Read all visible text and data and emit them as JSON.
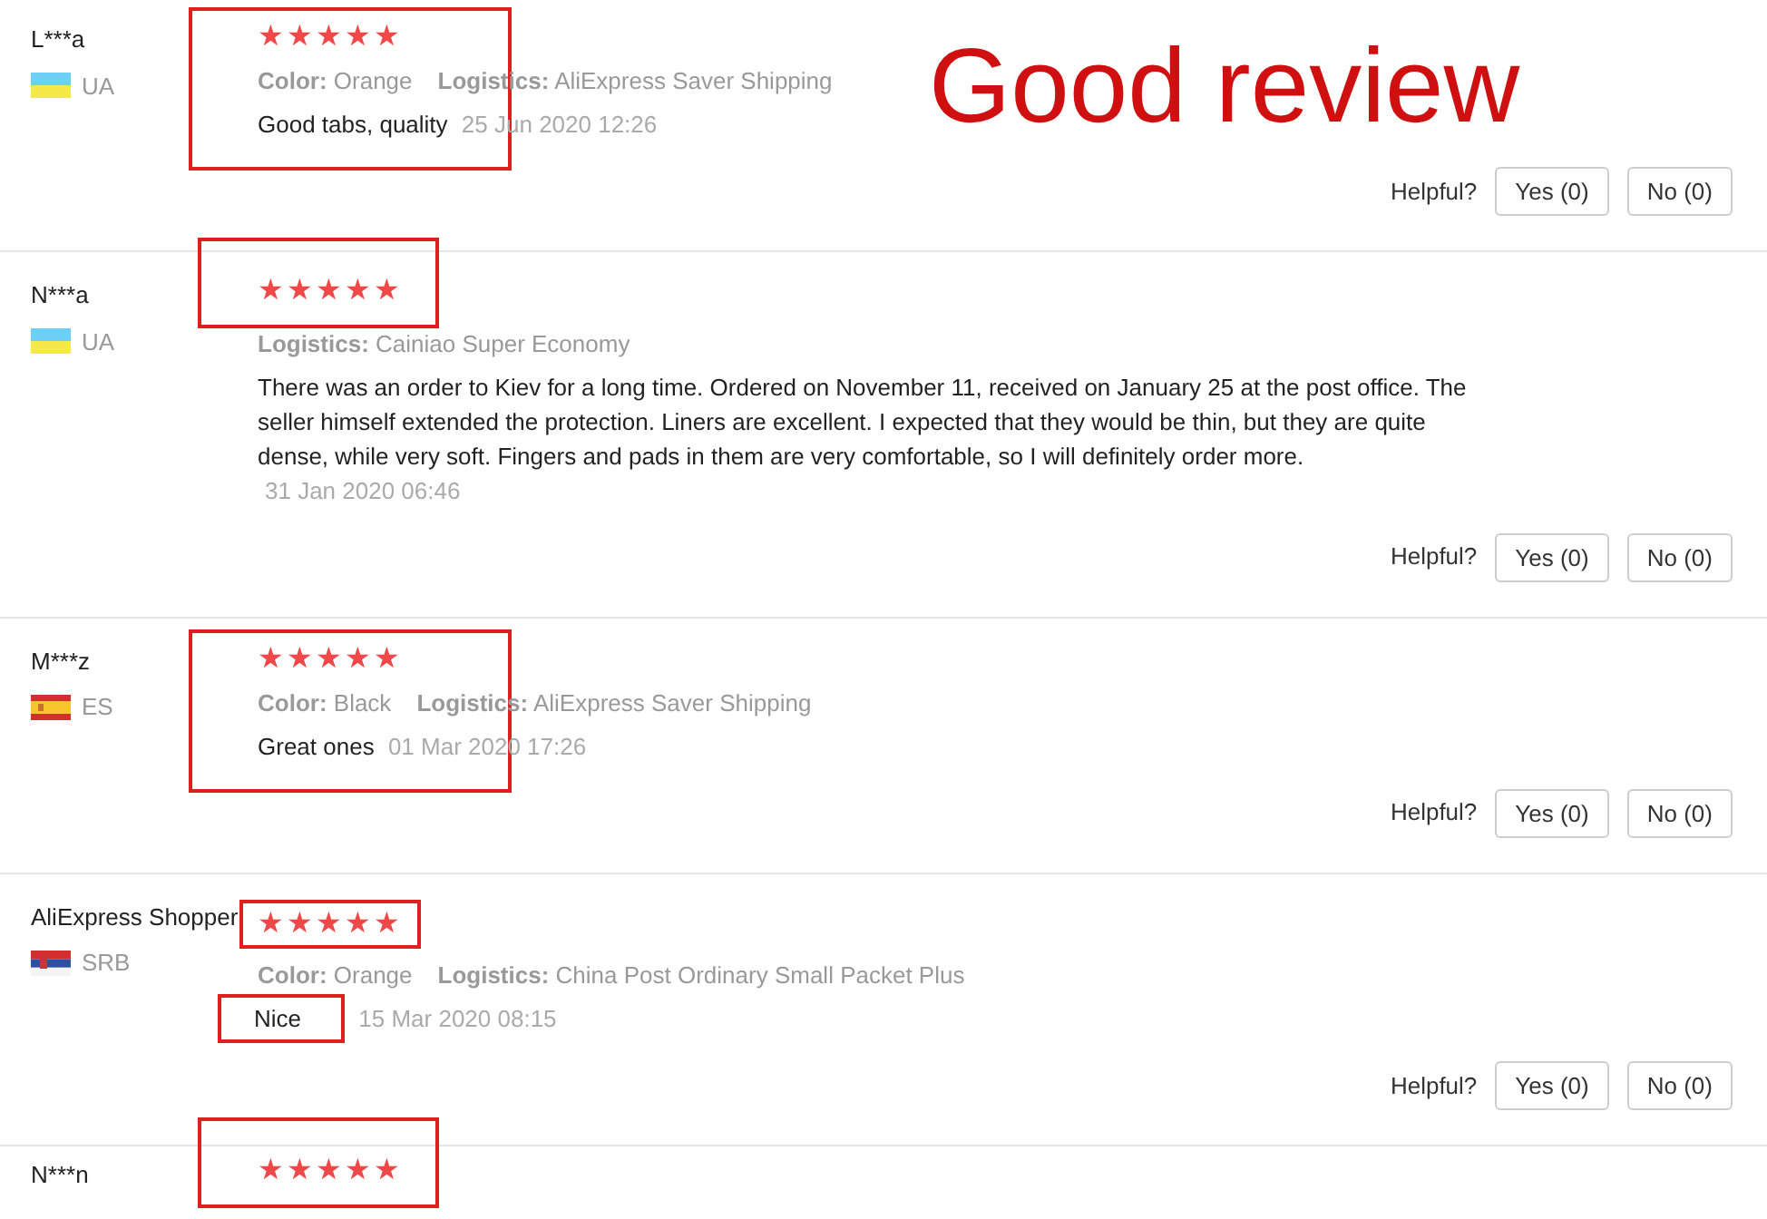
{
  "annotation_title": "Good review",
  "reviews": [
    {
      "name": "L***a",
      "flag": {
        "kind": "ukraine"
      },
      "country": "UA",
      "stars": 5,
      "meta": [
        "**Color:** Orange",
        "**Logistics:** AliExpress Saver Shipping"
      ],
      "text": "Good tabs, quality",
      "date": "25 Jun 2020 12:26",
      "helpful": {
        "label": "Helpful?",
        "yes": "Yes (0)",
        "no": "No (0)"
      },
      "highlights": [
        {
          "kind": "block"
        }
      ]
    },
    {
      "name": "N***a",
      "flag": {
        "kind": "ukraine"
      },
      "country": "UA",
      "stars": 5,
      "meta": [
        "**Logistics:** Cainiao Super Economy"
      ],
      "text": "There was an order to Kiev for a long time. Ordered on November 11, received on January 25 at the post office. The seller himself extended the protection. Liners are excellent. I expected that they would be thin, but they are quite dense, while very soft. Fingers and pads in them are very comfortable, so I will definitely order more.",
      "date": "31 Jan 2020 06:46",
      "helpful": {
        "label": "Helpful?",
        "yes": "Yes (0)",
        "no": "No (0)"
      },
      "highlights": [
        {
          "kind": "stars_large"
        }
      ]
    },
    {
      "name": "M***z",
      "flag": {
        "kind": "spain"
      },
      "country": "ES",
      "stars": 5,
      "meta": [
        "**Color:** Black",
        "**Logistics:** AliExpress Saver Shipping"
      ],
      "text": "Great ones",
      "date": "01 Mar 2020 17:26",
      "helpful": {
        "label": "Helpful?",
        "yes": "Yes (0)",
        "no": "No (0)"
      },
      "highlights": [
        {
          "kind": "block"
        }
      ]
    },
    {
      "name": "AliExpress Shopper",
      "flag": {
        "kind": "serbia"
      },
      "country": "SRB",
      "stars": 5,
      "meta": [
        "**Color:** Orange",
        "**Logistics:** China Post Ordinary Small Packet Plus"
      ],
      "text": "Nice",
      "date": "15 Mar 2020 08:15",
      "helpful": {
        "label": "Helpful?",
        "yes": "Yes (0)",
        "no": "No (0)"
      },
      "highlights": [
        {
          "kind": "stars"
        },
        {
          "kind": "text"
        }
      ]
    },
    {
      "name": "N***n",
      "stars": 5,
      "highlights": [
        {
          "kind": "stars_large"
        }
      ]
    }
  ]
}
